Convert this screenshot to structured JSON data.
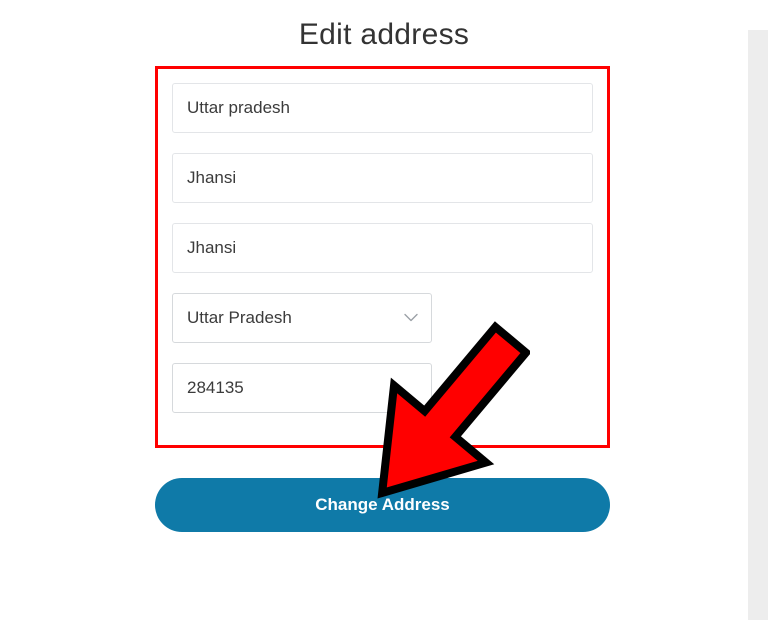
{
  "title": "Edit address",
  "form": {
    "state_input": "Uttar pradesh",
    "district": "Jhansi",
    "city": "Jhansi",
    "state_select": "Uttar Pradesh",
    "postal_code": "284135"
  },
  "button": {
    "change_address": "Change Address"
  }
}
